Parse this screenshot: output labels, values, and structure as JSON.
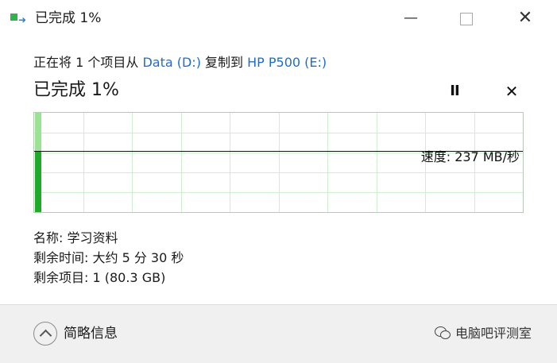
{
  "window": {
    "title": "已完成 1%",
    "minimize_glyph": "—",
    "close_glyph": "✕"
  },
  "copy": {
    "prefix": "正在将 1 个项目从 ",
    "source": "Data (D:)",
    "middle": " 复制到 ",
    "destination": "HP P500 (E:)"
  },
  "status": {
    "text": "已完成 1%",
    "percent": 1,
    "pause_glyph": "II",
    "cancel_glyph": "✕"
  },
  "graph": {
    "speed_label": "速度: 237 MB/秒",
    "speed_level": 0.62,
    "progress_fraction": 0.01
  },
  "details": {
    "name": "名称: 学习资料",
    "time_left": "剩余时间: 大约 5 分 30 秒",
    "items_left": "剩余项目: 1 (80.3 GB)"
  },
  "footer": {
    "less_details_label": "简略信息",
    "watermark_text": "电脑吧评测室"
  },
  "colors": {
    "link": "#1a6ed0",
    "graph_fill_light": "#9be196",
    "graph_fill_dark": "#1faa2a",
    "grid": "#cfeecf"
  },
  "icons": {
    "app": "copy-transfer-icon",
    "less_details": "chevron-up-icon",
    "watermark": "wechat-icon"
  }
}
